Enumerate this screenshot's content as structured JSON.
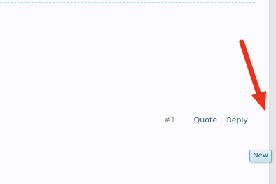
{
  "post": {
    "number": "#1",
    "actions": {
      "quote_label": "+ Quote",
      "reply_label": "Reply"
    }
  },
  "badge": {
    "label": "New"
  },
  "colors": {
    "link": "#2f5f76",
    "arrow": "#e8321c",
    "divider": "#a9dde6"
  },
  "annotation": {
    "icon": "red-arrow-icon"
  }
}
